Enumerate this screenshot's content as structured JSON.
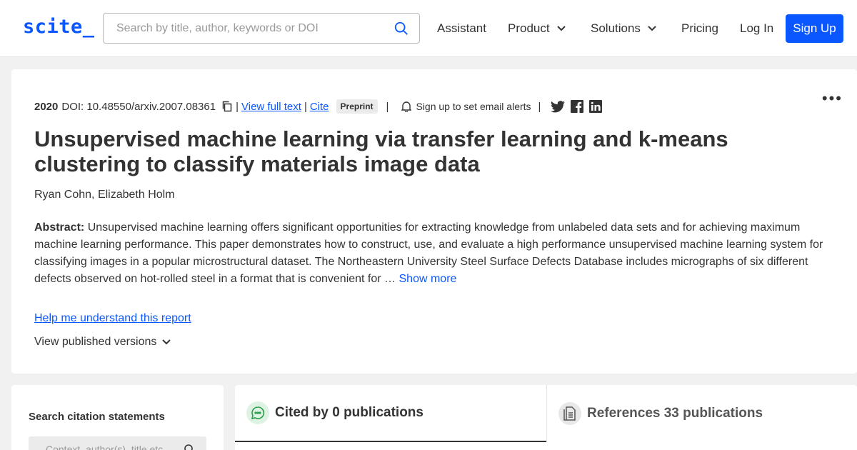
{
  "header": {
    "logo": "scite_",
    "search_placeholder": "Search by title, author, keywords or DOI",
    "nav": {
      "assistant": "Assistant",
      "product": "Product",
      "solutions": "Solutions",
      "pricing": "Pricing",
      "login": "Log In",
      "signup": "Sign Up"
    }
  },
  "paper": {
    "year": "2020",
    "doi": "DOI: 10.48550/arxiv.2007.08361",
    "view_full_text": "View full text",
    "cite": "Cite",
    "badge": "Preprint",
    "alerts": "Sign up to set email alerts",
    "title": "Unsupervised machine learning via transfer learning and k-means clustering to classify materials image data",
    "authors": "Ryan Cohn, Elizabeth Holm",
    "abstract_label": "Abstract:",
    "abstract_text": "Unsupervised machine learning offers significant opportunities for extracting knowledge from unlabeled data sets and for achieving maximum machine learning performance. This paper demonstrates how to construct, use, and evaluate a high performance unsupervised machine learning system for classifying images in a popular microstructural dataset. The Northeastern University Steel Surface Defects Database includes micrographs of six different defects observed on hot-rolled steel in a format that is convenient for …",
    "show_more": "Show more",
    "help": "Help me understand this report",
    "versions": "View published versions"
  },
  "sidebar": {
    "heading": "Search citation statements",
    "placeholder": "Context, author(s), title etc"
  },
  "tabs": {
    "cited": "Cited by 0 publications",
    "references": "References 33 publications"
  },
  "colors": {
    "accent": "#0b57ff",
    "cited_icon_bg": "#dff3e4",
    "cited_icon": "#2a9d4a"
  }
}
